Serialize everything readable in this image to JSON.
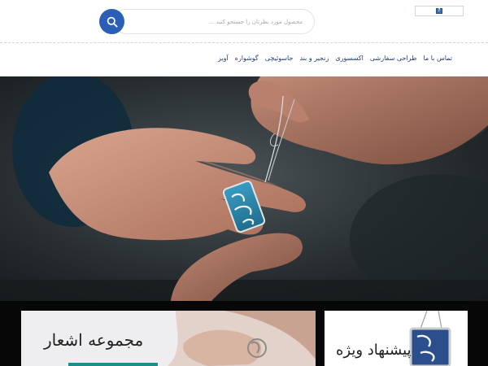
{
  "search": {
    "placeholder": "محصول مورد نظرتان را جستجو کنید ...",
    "icon": "search-icon",
    "button_color": "#2b5eb7"
  },
  "language": {
    "flag_icon": "language-flag-icon",
    "flag_label": "?"
  },
  "nav": {
    "items": [
      {
        "label": "آویز"
      },
      {
        "label": "گوشواره"
      },
      {
        "label": "جاسوئیچی"
      },
      {
        "label": "زنجیر و بند"
      },
      {
        "label": "اکسسوری"
      },
      {
        "label": "طراحی سفارشی"
      },
      {
        "label": "تماس با ما"
      }
    ],
    "color": "#1f3c78"
  },
  "hero": {
    "image": "hands-holding-calligraphy-pendant-photo",
    "pendant_color": "#2d7fa3"
  },
  "cards": {
    "left_title": "مجموعه اشعار",
    "right_title": "پیشنهاد ویژه",
    "accent_color": "#1b8e8b"
  }
}
